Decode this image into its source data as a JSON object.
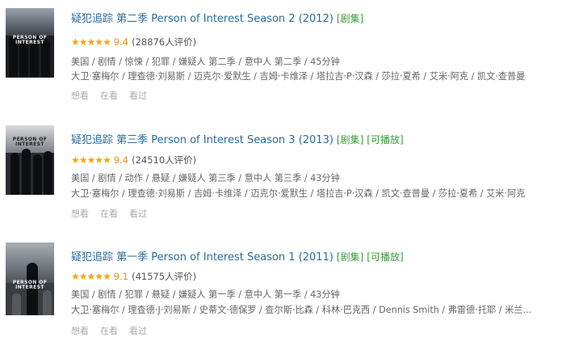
{
  "items": [
    {
      "title": "疑犯追踪 第二季 Person of Interest Season 2 (2012)",
      "tags": [
        "[剧集]"
      ],
      "stars": "★★★★★",
      "score": "9.4",
      "count": "(28876人评价)",
      "genres": "美国 / 剧情 / 惊悚 / 犯罪 / 嫌疑人 第二季 / 意中人 第二季 / 45分钟",
      "cast": "大卫·塞梅尔 / 理查德·刘易斯 / 迈克尔·爱默生 / 吉姆·卡维泽 / 塔拉吉·P·汉森 / 莎拉·夏希 / 艾米·阿克 / 凯文·查普曼",
      "actions": [
        "想看",
        "在看",
        "看过"
      ],
      "poster": {
        "line1": "PERSON OF",
        "line2": "INTEREST"
      }
    },
    {
      "title": "疑犯追踪 第三季 Person of Interest Season 3 (2013)",
      "tags": [
        "[剧集]",
        "[可播放]"
      ],
      "stars": "★★★★★",
      "score": "9.4",
      "count": "(24510人评价)",
      "genres": "美国 / 剧情 / 动作 / 悬疑 / 嫌疑人 第三季 / 意中人 第三季 / 43分钟",
      "cast": "大卫·塞梅尔 / 理查德·刘易斯 / 吉姆·卡维泽 / 迈克尔·爱默生 / 塔拉吉·P·汉森 / 凯文·查普曼 / 莎拉·夏希 / 艾米·阿克",
      "actions": [
        "想看",
        "在看",
        "看过"
      ],
      "poster": {
        "line1": "PERSON OF",
        "line2": "INTEREST"
      }
    },
    {
      "title": "疑犯追踪 第一季 Person of Interest Season 1 (2011)",
      "tags": [
        "[剧集]",
        "[可播放]"
      ],
      "stars": "★★★★★",
      "score": "9.1",
      "count": "(41575人评价)",
      "genres": "美国 / 剧情 / 犯罪 / 悬疑 / 嫌疑人 第一季 / 意中人 第一季 / 43分钟",
      "cast": "大卫·塞梅尔 / 理查德·J·刘易斯 / 史蒂文·德保罗 / 查尔斯·比森 / 科林·巴克西 / Dennis Smith / 弗雷德·托耶 / 米兰...",
      "actions": [
        "想看",
        "在看",
        "看过"
      ],
      "poster": {
        "line1": "PERSON OF",
        "line2": "INTEREST"
      }
    }
  ],
  "colors": {
    "title": "#2b6c9c",
    "tag": "#3a9a3a",
    "star": "#f3a712",
    "score": "#e09015"
  }
}
